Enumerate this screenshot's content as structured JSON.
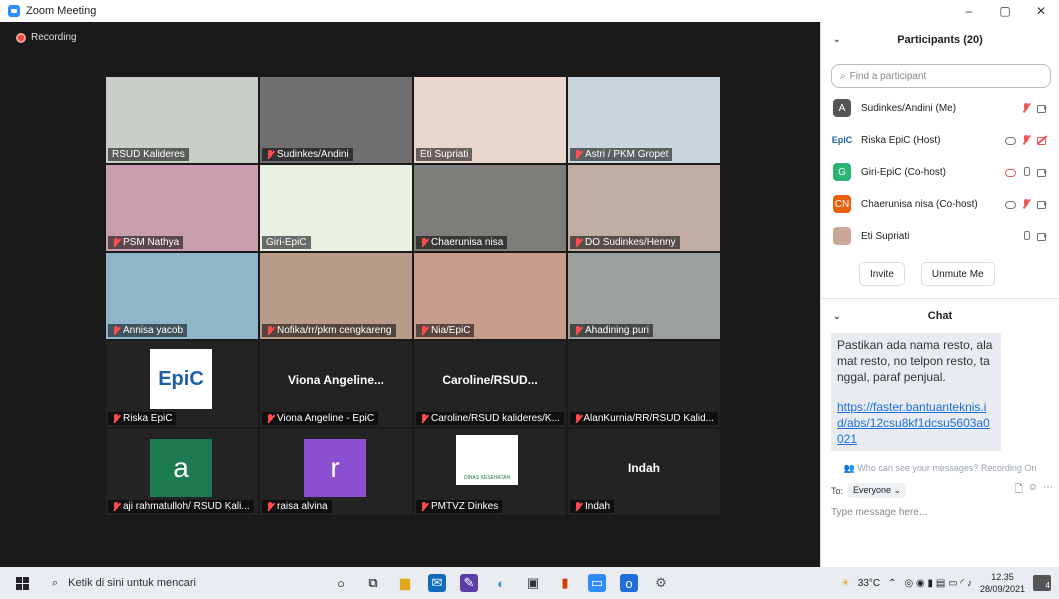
{
  "window": {
    "title": "Zoom Meeting",
    "controls": [
      "–",
      "▢",
      "✕"
    ]
  },
  "recording": {
    "label": "Recording"
  },
  "tiles": [
    {
      "name": "RSUD Kalideres",
      "muted": false,
      "bg": "#c8cfc7"
    },
    {
      "name": "Sudinkes/Andini",
      "muted": true,
      "bg": "#6f6f6f"
    },
    {
      "name": "Eti Supriati",
      "muted": false,
      "bg": "#e8d5cb"
    },
    {
      "name": "Astri / PKM Gropet",
      "muted": true,
      "bg": "#cbd6dc"
    },
    {
      "name": "PSM Nathya",
      "muted": true,
      "bg": "#c99faf"
    },
    {
      "name": "Giri-EpiC",
      "muted": false,
      "bg": "#e8efe3",
      "active": true
    },
    {
      "name": "Chaerunisa nisa",
      "muted": true,
      "bg": "#7f7d7a"
    },
    {
      "name": "DO Sudinkes/Henny",
      "muted": true,
      "bg": "#c1aca3"
    },
    {
      "name": "Annisa yacob",
      "muted": true,
      "bg": "#8fb5c9"
    },
    {
      "name": "Nofika/rr/pkm cengkareng",
      "muted": true,
      "bg": "#b89a88"
    },
    {
      "name": "Nia/EpiC",
      "muted": true,
      "bg": "#c79c8a"
    },
    {
      "name": "Ahadining puri",
      "muted": true,
      "bg": "#9aa09b"
    },
    {
      "name": "Riska EpiC",
      "muted": true,
      "bg": "#232323",
      "logo": "EpiC"
    },
    {
      "name": "Viona Angeline - EpiC",
      "muted": true,
      "bg": "#232323",
      "bigname": "Viona Angeline..."
    },
    {
      "name": "Caroline/RSUD kalideres/K...",
      "muted": true,
      "bg": "#232323",
      "bigname": "Caroline/RSUD..."
    },
    {
      "name": "AlanKurnia/RR/RSUD Kalid...",
      "muted": true,
      "bg": "#232323"
    },
    {
      "name": "aji rahmatulloh/ RSUD Kali...",
      "muted": true,
      "bg": "#232323",
      "avatar": "a",
      "avatar_color": "#1e7a52"
    },
    {
      "name": "raisa alvina",
      "muted": true,
      "bg": "#232323",
      "avatar": "r",
      "avatar_color": "#8a4fd1"
    },
    {
      "name": "PMTVZ Dinkes",
      "muted": true,
      "bg": "#232323",
      "logo_text": "DINAS KESEHATAN"
    },
    {
      "name": "Indah",
      "muted": true,
      "bg": "#232323",
      "bigname": "Indah"
    }
  ],
  "participants": {
    "header": "Participants (20)",
    "search_placeholder": "Find a participant",
    "list": [
      {
        "avatar": "A",
        "color": "#555555",
        "name": "Sudinkes/Andini (Me)",
        "icons": [
          "mic-red",
          "cam"
        ]
      },
      {
        "avatar": "EpiC",
        "color": "#ffffff",
        "name": "Riska EpiC (Host)",
        "icons": [
          "cloud",
          "mic-red",
          "cam-red"
        ]
      },
      {
        "avatar": "G",
        "color": "#2ab573",
        "name": "Giri-EpiC (Co-host)",
        "icons": [
          "cloud-red",
          "mic-gray",
          "cam"
        ]
      },
      {
        "avatar": "CN",
        "color": "#e8600c",
        "name": "Chaerunisa nisa (Co-host)",
        "icons": [
          "cloud",
          "mic-red",
          "cam"
        ]
      },
      {
        "avatar": "",
        "color": "#c9a89a",
        "name": "Eti Supriati",
        "icons": [
          "mic-gray",
          "cam"
        ]
      }
    ],
    "invite_label": "Invite",
    "unmute_label": "Unmute Me"
  },
  "chat": {
    "header": "Chat",
    "message": "Pastikan ada nama resto, alamat resto, no telpon resto, tanggal, paraf penjual.",
    "link": "https://faster.bantuanteknis.id/abs/12csu8kf1dcsu5603a0021",
    "who_can_see": "Who can see your messages? Recording On",
    "to_label": "To:",
    "to_value": "Everyone ⌄",
    "placeholder": "Type message here..."
  },
  "taskbar": {
    "search_placeholder": "Ketik di sini untuk mencari",
    "weather": "33°C",
    "time": "12.35",
    "date": "28/09/2021",
    "notifications": "4"
  }
}
